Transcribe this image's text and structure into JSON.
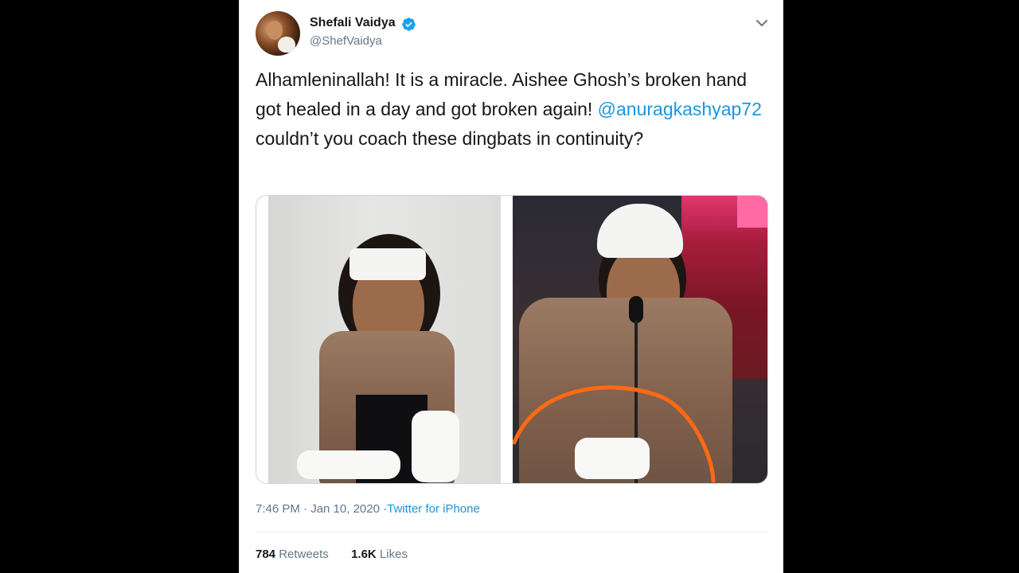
{
  "tweet": {
    "author_name": "Shefali Vaidya",
    "author_handle": "@ShefVaidya",
    "verified": true,
    "text_parts": {
      "before_mention": "Alhamleninallah! It is a miracle. Aishee Ghosh’s broken hand got healed in a day and got broken again! ",
      "mention": "@anuragkashyap72",
      "after_mention": " couldn’t you coach these dingbats in continuity?"
    },
    "timestamp": "7:46 PM · Jan 10, 2020",
    "source_separator": " · ",
    "source": "Twitter for iPhone",
    "retweets_count": "784",
    "retweets_label": "Retweets",
    "likes_count": "1.6K",
    "likes_label": "Likes"
  },
  "icons": {
    "verified": "verified-badge-icon",
    "caret": "chevron-down-icon"
  },
  "colors": {
    "link": "#1b95e0",
    "text": "#14171a",
    "secondary": "#657786",
    "verified": "#1da1f2",
    "annotation_circle": "#ff6a13"
  }
}
